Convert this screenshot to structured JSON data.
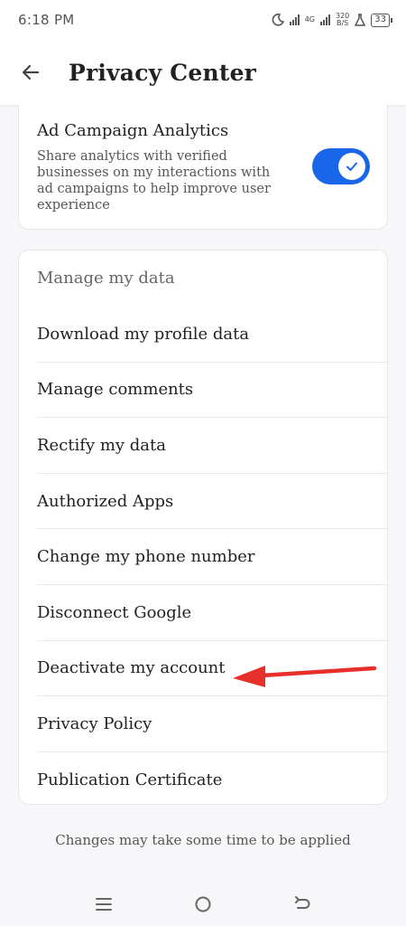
{
  "status_bar": {
    "time": "6:18 PM",
    "network": "4G",
    "speed_top": "320",
    "speed_bottom": "B/S",
    "battery": "33"
  },
  "app_bar": {
    "title": "Privacy Center",
    "back_icon": "arrow-left-icon"
  },
  "ad_campaign": {
    "title": "Ad Campaign Analytics",
    "description": "Share analytics with verified businesses on my interactions with ad campaigns to help improve user experience",
    "toggle_on": true,
    "accent": "#1a66e8"
  },
  "manage_data": {
    "header": "Manage my data",
    "items": [
      {
        "label": "Download my profile data"
      },
      {
        "label": "Manage comments"
      },
      {
        "label": "Rectify my data"
      },
      {
        "label": "Authorized Apps"
      },
      {
        "label": "Change my phone number"
      },
      {
        "label": "Disconnect Google"
      },
      {
        "label": "Deactivate my account"
      },
      {
        "label": "Privacy Policy"
      },
      {
        "label": "Publication Certificate"
      }
    ]
  },
  "footer_note": "Changes may take some time to be applied",
  "nav_bar": {
    "menu_icon": "menu-icon",
    "home_icon": "home-circle-icon",
    "back_icon": "back-arrow-icon"
  },
  "annotation": {
    "color": "#e8302b",
    "icon": "red-arrow-annotation"
  }
}
